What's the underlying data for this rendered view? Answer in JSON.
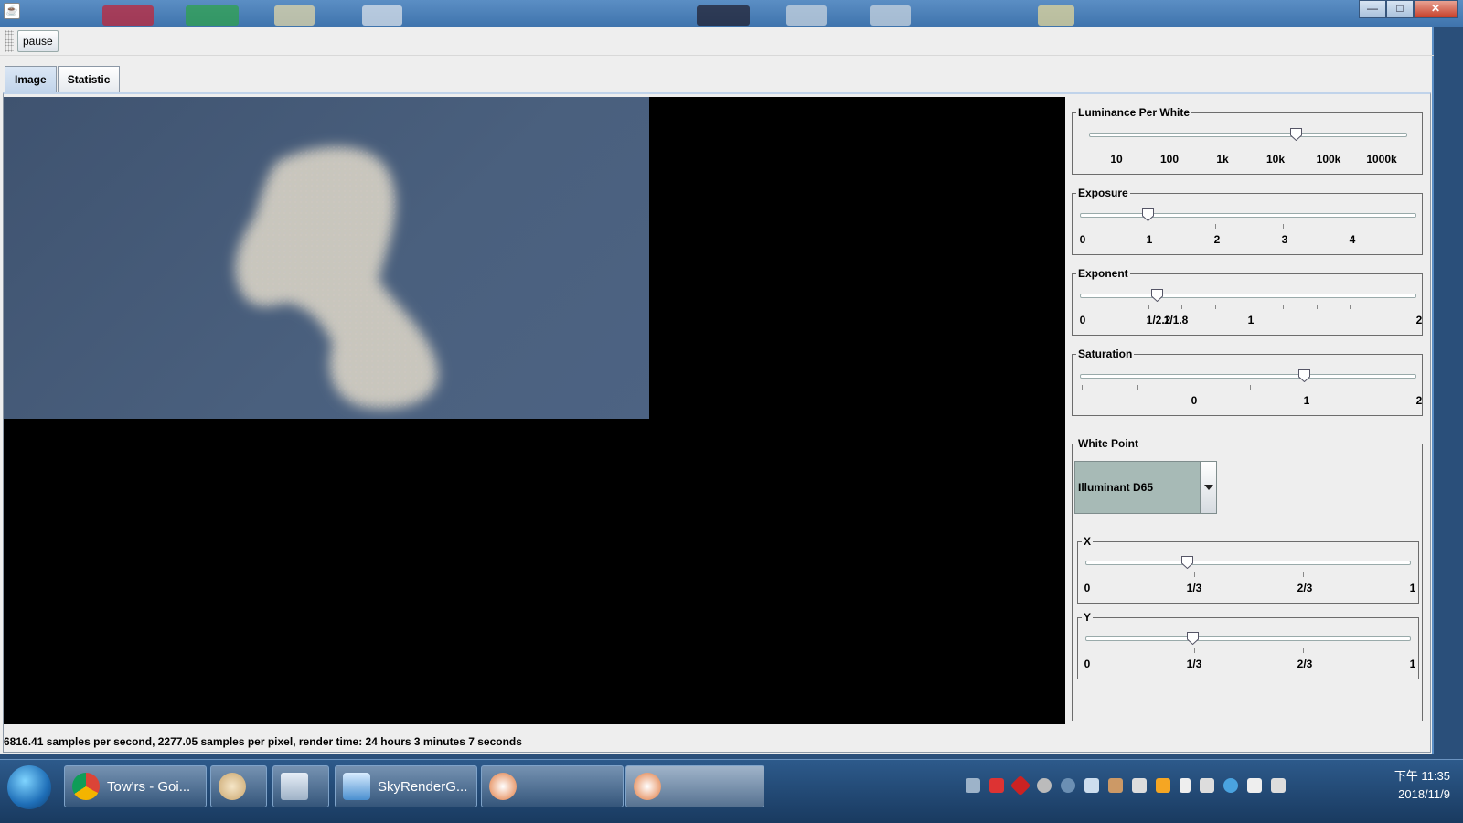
{
  "window": {
    "close_glyph": "✕",
    "max_glyph": "□",
    "min_glyph": "—",
    "java_glyph": "☕"
  },
  "toolbar": {
    "pause_label": "pause"
  },
  "tabs": [
    {
      "label": "Image"
    },
    {
      "label": "Statistic"
    }
  ],
  "controls": {
    "luminance": {
      "title": "Luminance Per White",
      "labels": [
        "10",
        "100",
        "1k",
        "10k",
        "100k",
        "1000k"
      ],
      "value_fraction": 0.65
    },
    "exposure": {
      "title": "Exposure",
      "labels": [
        "0",
        "1",
        "2",
        "3",
        "4"
      ],
      "value": 1.0,
      "max": 5
    },
    "exponent": {
      "title": "Exponent",
      "labels": [
        "0",
        "1/2.2",
        "1/1.8",
        "1",
        "2"
      ],
      "value": 0.455,
      "max": 2
    },
    "saturation": {
      "title": "Saturation",
      "labels": [
        "0",
        "1",
        "2"
      ],
      "value": 1.0,
      "min": -1,
      "max": 2
    },
    "white_point": {
      "title": "White Point",
      "selected": "Illuminant D65"
    },
    "x": {
      "title": "X",
      "labels": [
        "0",
        "1/3",
        "2/3",
        "1"
      ],
      "value": 0.313
    },
    "y": {
      "title": "Y",
      "labels": [
        "0",
        "1/3",
        "2/3",
        "1"
      ],
      "value": 0.329
    }
  },
  "status": {
    "text": "6816.41 samples per second,    2277.05 samples per pixel,    render time: 24 hours 3 minutes 7 seconds"
  },
  "taskbar": {
    "items": [
      {
        "label": "Tow'rs - Goi..."
      },
      {
        "label": ""
      },
      {
        "label": ""
      },
      {
        "label": "SkyRenderG..."
      },
      {
        "label": ""
      },
      {
        "label": ""
      }
    ],
    "clock_time": "下午 11:35",
    "clock_date": "2018/11/9"
  },
  "colors": {
    "accent": "#5b8ec4",
    "render_bg": "#46597a",
    "cloud": "#c9c6bd"
  }
}
